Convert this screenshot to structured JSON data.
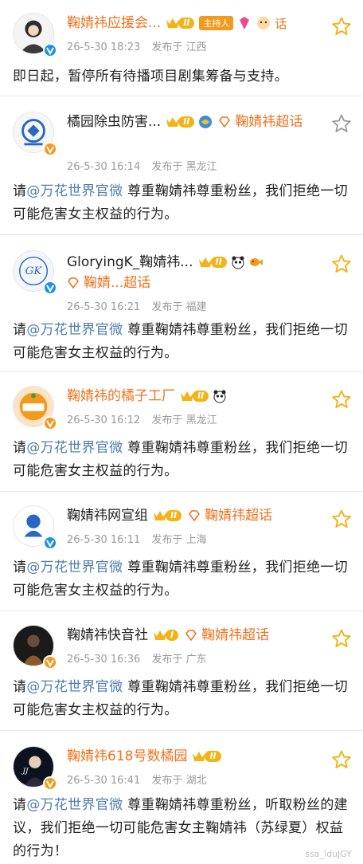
{
  "colors": {
    "accent_orange": "#f0711c",
    "link_blue": "#507daf",
    "meta_gray": "#9a9a9a",
    "star_gold": "#f2b51d",
    "divider": "#e7e7e7"
  },
  "posts": [
    {
      "name": "鞠婧祎应援会...",
      "level": "II",
      "host_tag": "主持人",
      "supertopic": "话",
      "time": "26-5-30 18:23",
      "location": "发布于 江西",
      "text": "即日起，暂停所有待播项目剧集筹备与支持。",
      "icon": "star-outline-icon"
    },
    {
      "name": "橘园除虫防害...",
      "level": "II",
      "supertopic": "鞠婧祎超话",
      "time": "26-5-30 16:14",
      "location": "发布于 黑龙江",
      "text_pre": "请",
      "mention": "@万花世界官微",
      "text_post": " 尊重鞠婧祎尊重粉丝，我们拒绝一切可能危害女主权益的行为。"
    },
    {
      "name": "GloryingK_鞠婧祎...",
      "level": "II",
      "supertopic": "鞠婧...超话",
      "time": "26-5-30 16:21",
      "location": "发布于 福建",
      "text_pre": "请",
      "mention": "@万花世界官微",
      "text_post": " 尊重鞠婧祎尊重粉丝，我们拒绝一切可能危害女主权益的行为。"
    },
    {
      "name": "鞠婧祎的橘子工厂",
      "level": "II",
      "time": "26-5-30 16:12",
      "location": "发布于 黑龙江",
      "text_pre": "请",
      "mention": "@万花世界官微",
      "text_post": " 尊重鞠婧祎尊重粉丝，我们拒绝一切可能危害女主权益的行为。"
    },
    {
      "name": "鞠婧祎网宣组",
      "level": "II",
      "supertopic": "鞠婧祎超话",
      "time": "26-5-30 16:11",
      "location": "发布于 上海",
      "text_pre": "请",
      "mention": "@万花世界官微",
      "text_post": " 尊重鞠婧祎尊重粉丝，我们拒绝一切可能危害女主权益的行为。"
    },
    {
      "name": "鞠婧祎快音社",
      "level": "I",
      "supertopic": "鞠婧祎超话",
      "time": "26-5-30 16:36",
      "location": "发布于 广东",
      "text_pre": "请",
      "mention": "@万花世界官微",
      "text_post": " 尊重鞠婧祎尊重粉丝，我们拒绝一切可能危害女主权益的行为。"
    },
    {
      "name": "鞠婧祎618号数橘园",
      "level": "II",
      "time": "26-5-30 16:41",
      "location": "发布于 湖北",
      "text_pre": "请",
      "mention": "@万花世界官微",
      "text_post": " 尊重鞠婧祎尊重粉丝，听取粉丝的建议，我们拒绝一切可能危害女主鞠婧祎（苏绿夏）权益的行为！"
    }
  ],
  "watermark": "ssa_lduJGY"
}
